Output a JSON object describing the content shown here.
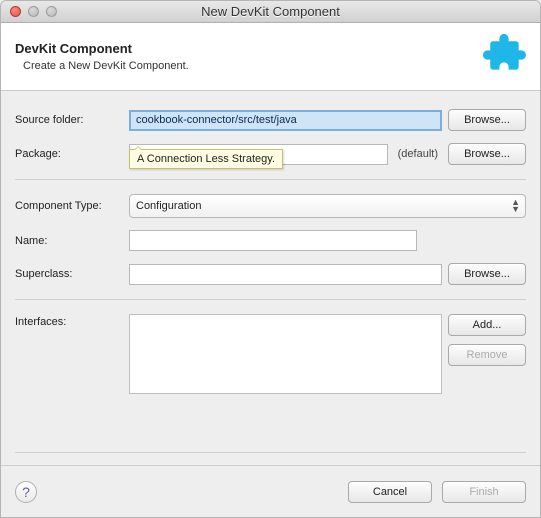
{
  "window": {
    "title": "New DevKit Component"
  },
  "header": {
    "title": "DevKit Component",
    "subtitle": "Create a New DevKit Component."
  },
  "form": {
    "source_folder": {
      "label": "Source folder:",
      "value": "cookbook-connector/src/test/java",
      "browse": "Browse..."
    },
    "package": {
      "label": "Package:",
      "value": "",
      "default_text": "(default)",
      "browse": "Browse..."
    },
    "component_type": {
      "label": "Component Type:",
      "value": "Configuration"
    },
    "name": {
      "label": "Name:",
      "value": ""
    },
    "superclass": {
      "label": "Superclass:",
      "value": "",
      "browse": "Browse..."
    },
    "interfaces": {
      "label": "Interfaces:",
      "add": "Add...",
      "remove": "Remove"
    }
  },
  "tooltip": {
    "text": "A Connection Less Strategy."
  },
  "footer": {
    "cancel": "Cancel",
    "finish": "Finish"
  },
  "colors": {
    "accent": "#1fb6e8"
  }
}
